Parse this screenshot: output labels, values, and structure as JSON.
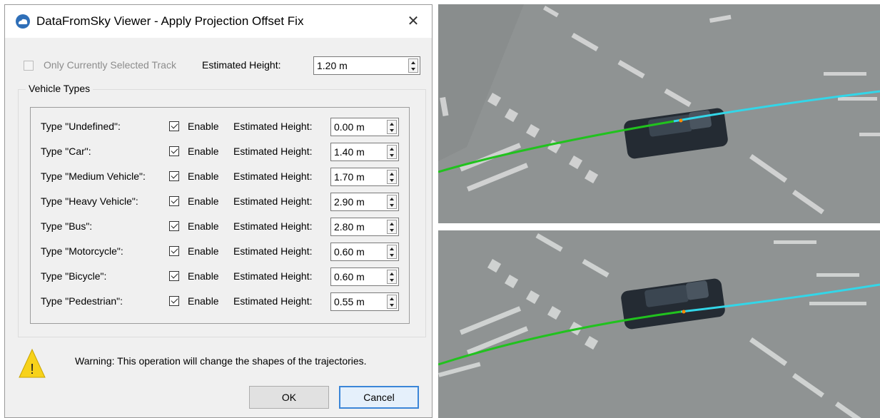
{
  "dialog": {
    "title": "DataFromSky Viewer - Apply Projection Offset Fix",
    "close_symbol": "✕",
    "icon": "cloud-icon",
    "only_selected_label": "Only Currently Selected Track",
    "estimated_height_label": "Estimated Height:",
    "estimated_height_value": "1.20 m",
    "group_title": "Vehicle Types",
    "enable_label": "Enable",
    "vehicle_types": [
      {
        "label": "Type \"Undefined\":",
        "value": "0.00 m"
      },
      {
        "label": "Type \"Car\":",
        "value": "1.40 m"
      },
      {
        "label": "Type \"Medium Vehicle\":",
        "value": "1.70 m"
      },
      {
        "label": "Type \"Heavy Vehicle\":",
        "value": "2.90 m"
      },
      {
        "label": "Type \"Bus\":",
        "value": "2.80 m"
      },
      {
        "label": "Type \"Motorcycle\":",
        "value": "0.60 m"
      },
      {
        "label": "Type \"Bicycle\":",
        "value": "0.60 m"
      },
      {
        "label": "Type \"Pedestrian\":",
        "value": "0.55 m"
      }
    ],
    "warning_icon_glyph": "!",
    "warning_text": "Warning: This operation will change the shapes of the trajectories.",
    "ok_label": "OK",
    "cancel_label": "Cancel"
  },
  "photos": {
    "colors": {
      "road": "#8f9393",
      "trajectory_past": "#21c21e",
      "trajectory_future": "#33d6e8",
      "car": "#262d35"
    }
  }
}
